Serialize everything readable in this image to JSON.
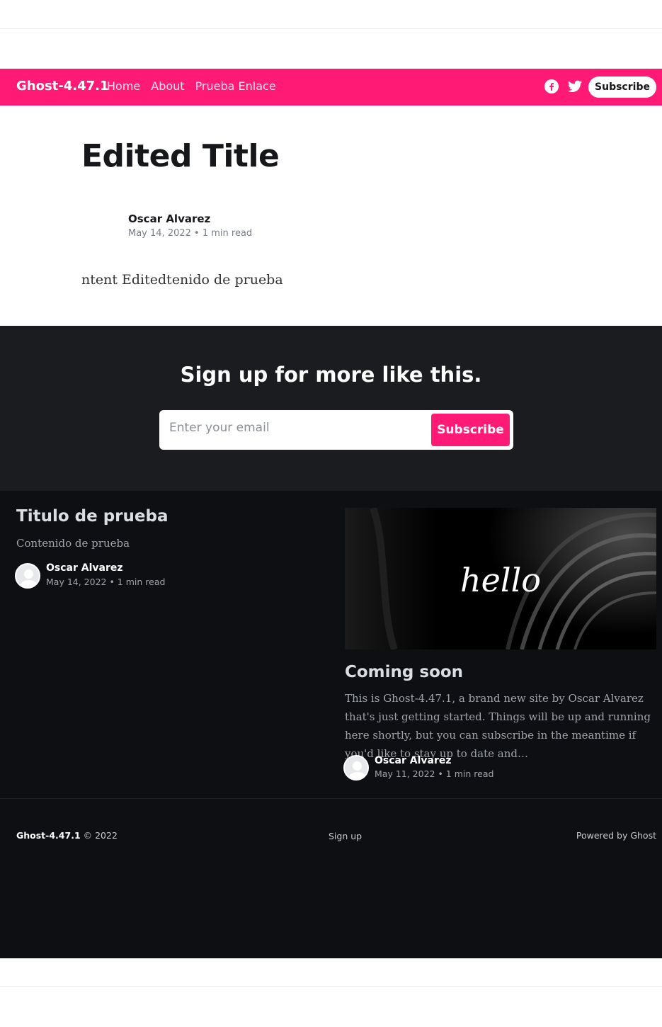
{
  "header": {
    "brand": "Ghost-4.47.1",
    "nav": [
      "Home",
      "About",
      "Prueba Enlace"
    ],
    "social": [
      "facebook-icon",
      "twitter-icon"
    ],
    "subscribe_label": "Subscribe",
    "accent_color": "#ff1a75"
  },
  "post": {
    "title": "Edited Title",
    "author": "Oscar Alvarez",
    "meta": "May 14, 2022 • 1 min read",
    "body": "ntent Editedtenido de prueba"
  },
  "cta": {
    "title": "Sign up for more like this.",
    "email_placeholder": "Enter your email",
    "button_label": "Subscribe"
  },
  "related": [
    {
      "title": "Titulo de prueba",
      "excerpt": "Contenido de prueba",
      "author": "Oscar Alvarez",
      "meta": "May 14, 2022 • 1 min read"
    },
    {
      "title": "Coming soon",
      "image_text": "hello",
      "excerpt": "This is Ghost-4.47.1, a brand new site by Oscar Alvarez that's just getting started. Things will be up and running here shortly, but you can subscribe in the meantime if you'd like to stay up to date and…",
      "author": "Oscar Alvarez",
      "meta": "May 11, 2022 • 1 min read"
    }
  ],
  "footer": {
    "site": "Ghost-4.47.1",
    "copyright": "© 2022",
    "signup": "Sign up",
    "powered": "Powered by Ghost"
  }
}
